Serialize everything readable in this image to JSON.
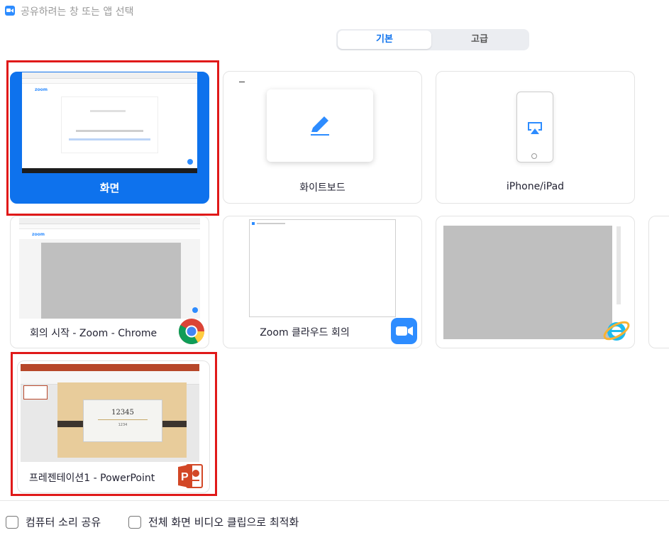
{
  "window": {
    "title": "공유하려는 창 또는 앱 선택"
  },
  "tabs": [
    {
      "label": "기본",
      "active": true
    },
    {
      "label": "고급",
      "active": false
    }
  ],
  "tiles": {
    "screen": {
      "label": "화면",
      "selected": true
    },
    "whiteboard": {
      "label": "화이트보드"
    },
    "iphone_ipad": {
      "label": "iPhone/iPad"
    },
    "chrome_window": {
      "label": "회의 시작 - Zoom - Chrome",
      "app_icon": "chrome-icon"
    },
    "zoom_cloud": {
      "label": "Zoom 클라우드 회의",
      "app_icon": "zoom-icon"
    },
    "ie_window": {
      "app_icon": "internet-explorer-icon"
    },
    "powerpoint": {
      "label": "프레젠테이션1 - PowerPoint",
      "app_icon": "powerpoint-icon",
      "slide_title": "12345",
      "slide_subtitle": "1234"
    }
  },
  "options": {
    "share_sound_label": "컴퓨터 소리 공유",
    "optimize_video_label": "전체 화면 비디오 클립으로 최적화"
  },
  "colors": {
    "accent": "#0e72ed",
    "highlight": "#e01919",
    "zoom_brand": "#2D8CFF"
  }
}
